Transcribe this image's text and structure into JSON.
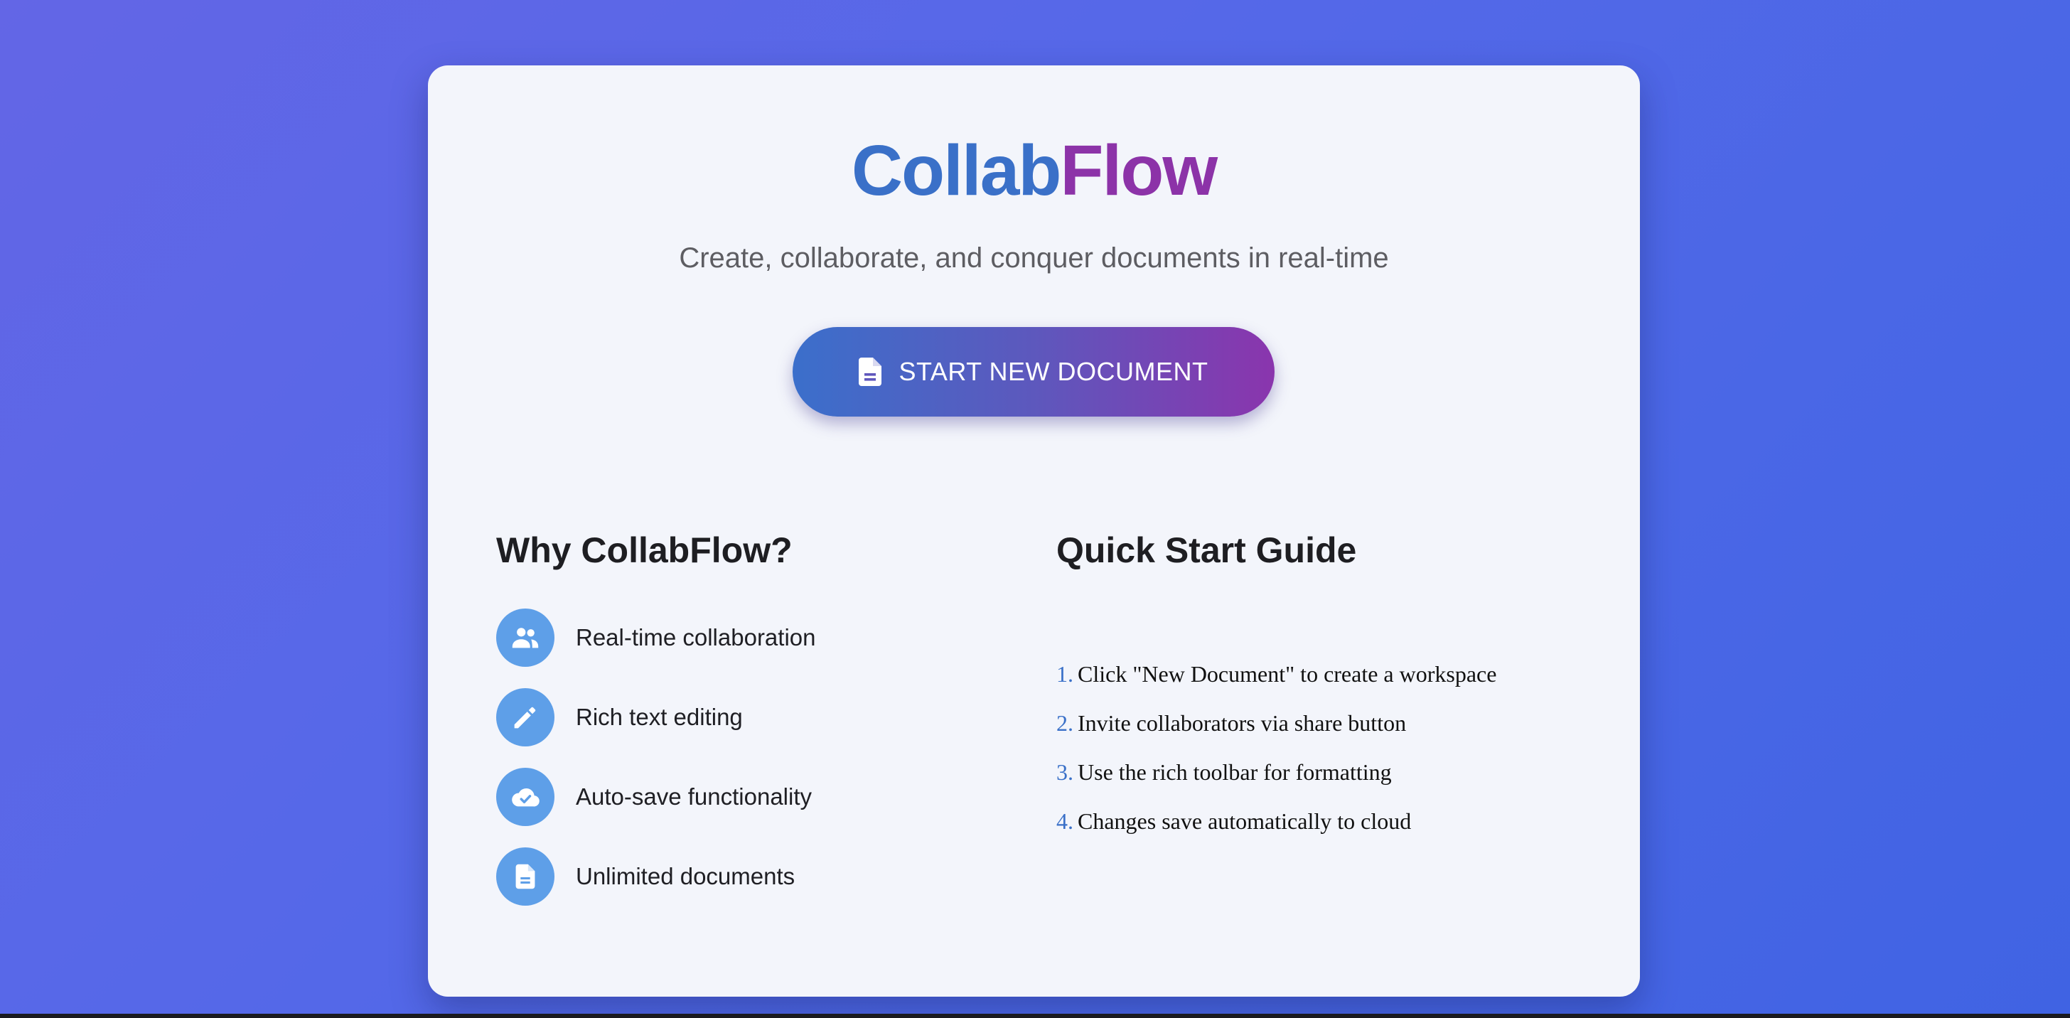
{
  "brand": {
    "part1": "Collab",
    "part2": "Flow"
  },
  "tagline": "Create, collaborate, and conquer documents in real-time",
  "cta": {
    "label": "START NEW DOCUMENT",
    "icon": "document-icon"
  },
  "why": {
    "title": "Why CollabFlow?",
    "features": [
      {
        "label": "Real-time collaboration",
        "icon": "people-icon"
      },
      {
        "label": "Rich text editing",
        "icon": "pencil-icon"
      },
      {
        "label": "Auto-save functionality",
        "icon": "cloud-check-icon"
      },
      {
        "label": "Unlimited documents",
        "icon": "document-icon"
      }
    ]
  },
  "guide": {
    "title": "Quick Start Guide",
    "steps": [
      {
        "num": "1.",
        "text": "Click \"New Document\" to create a workspace"
      },
      {
        "num": "2.",
        "text": "Invite collaborators via share button"
      },
      {
        "num": "3.",
        "text": "Use the rich toolbar for formatting"
      },
      {
        "num": "4.",
        "text": "Changes save automatically to cloud"
      }
    ]
  },
  "colors": {
    "primary": "#3a70c8",
    "accent": "#8c33a8",
    "icon_bg": "#5e9fe8",
    "background": "#5568e8",
    "card": "#f3f5fb"
  }
}
